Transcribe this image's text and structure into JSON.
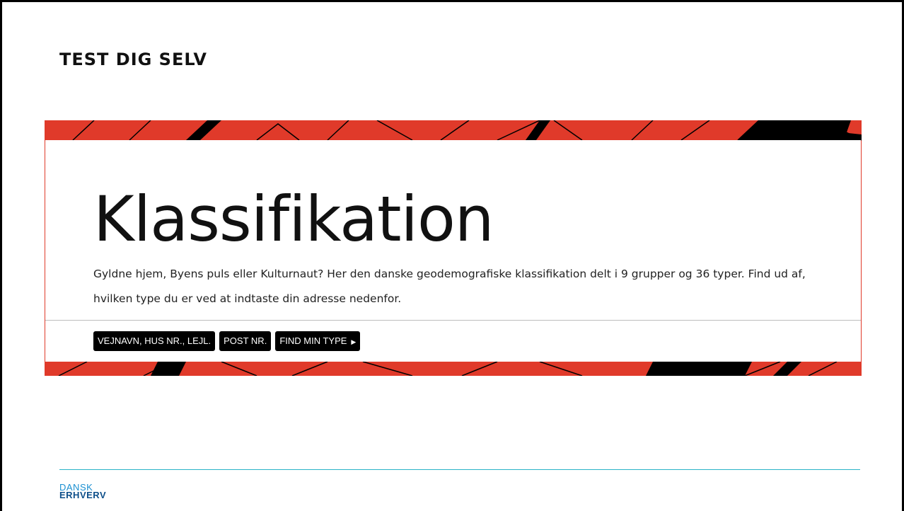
{
  "slide": {
    "title": "TEST DIG SELV"
  },
  "embed": {
    "heading": "Klassifikation",
    "description": "Gyldne hjem, Byens puls eller Kulturnaut? Her den danske geodemografiske klassifikation delt i 9 grupper og 36 typer. Find ud af, hvilken type du er ved at indtaste din adresse nedenfor.",
    "street_label": "VEJNAVN, HUS NR., LEJL.",
    "postal_label": "POST NR.",
    "find_label": "FIND MIN TYPE",
    "accent_color": "#e03a2a"
  },
  "footer": {
    "logo_line1": "DANSK",
    "logo_line2": "ERHVERV",
    "rule_color": "#2ab4c8"
  }
}
